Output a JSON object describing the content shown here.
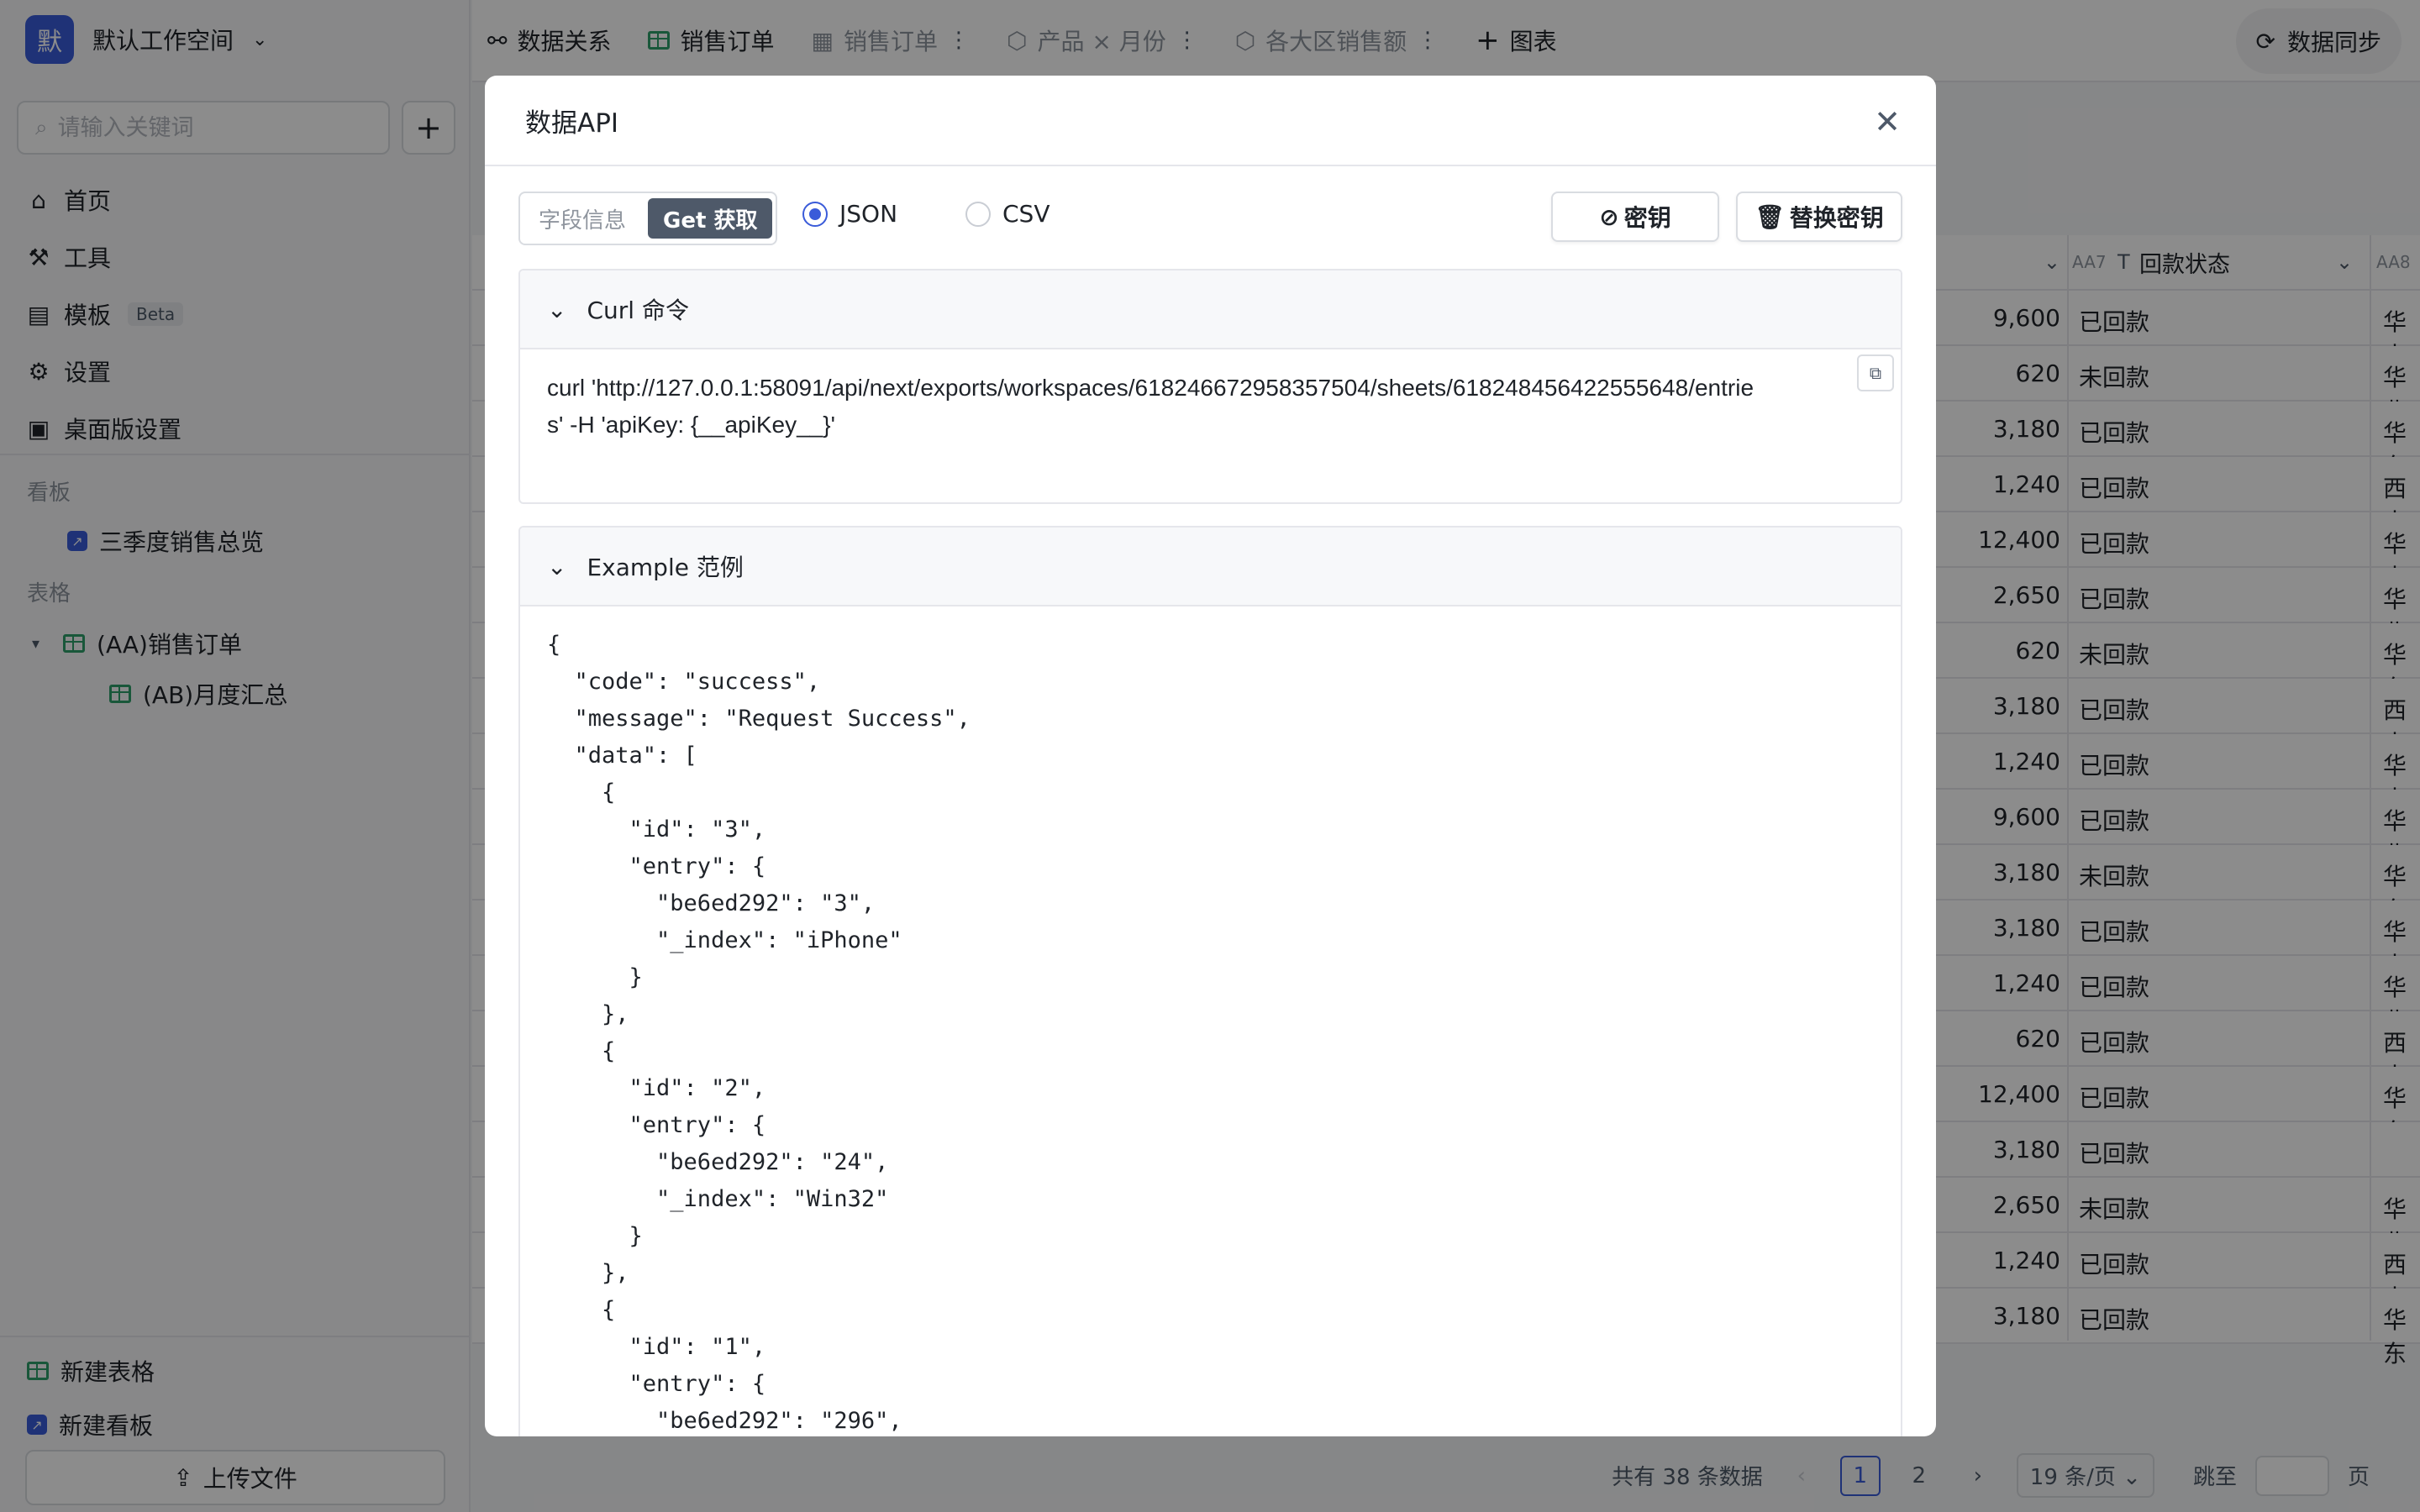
{
  "workspace": {
    "avatar": "默",
    "name": "默认工作空间"
  },
  "search": {
    "placeholder": "请输入关键词"
  },
  "nav": [
    {
      "label": "首页",
      "icon": "home-icon",
      "glyph": "⌂"
    },
    {
      "label": "工具",
      "icon": "wrench-icon",
      "glyph": "⚒"
    },
    {
      "label": "模板",
      "icon": "template-icon",
      "glyph": "▤",
      "badge": "Beta"
    },
    {
      "label": "设置",
      "icon": "gear-icon",
      "glyph": "⚙"
    },
    {
      "label": "桌面版设置",
      "icon": "desktop-icon",
      "glyph": "▣"
    }
  ],
  "sections": {
    "boards": "看板",
    "tables": "表格"
  },
  "tree": {
    "board1": "三季度销售总览",
    "table1": "(AA)销售订单",
    "table2": "(AB)月度汇总"
  },
  "bottom": {
    "new_table": "新建表格",
    "new_board": "新建看板",
    "upload": "上传文件"
  },
  "tabs": [
    {
      "label": "数据关系",
      "muted": false,
      "more": false
    },
    {
      "label": "销售订单",
      "muted": false,
      "more": false
    },
    {
      "label": "销售订单",
      "muted": true,
      "more": true
    },
    {
      "label": "产品 × 月份",
      "muted": true,
      "more": true
    },
    {
      "label": "各大区销售额",
      "muted": true,
      "more": true
    },
    {
      "label": "图表",
      "muted": false,
      "more": false
    }
  ],
  "sync": {
    "label": "数据同步"
  },
  "table": {
    "col_aa7_code": "AA7",
    "col_aa7_label": "回款状态",
    "col_aa8_code": "AA8",
    "rows": [
      {
        "amount": "9,600",
        "status": "已回款",
        "region": "华南"
      },
      {
        "amount": "620",
        "status": "未回款",
        "region": "华北"
      },
      {
        "amount": "3,180",
        "status": "已回款",
        "region": "华东"
      },
      {
        "amount": "1,240",
        "status": "已回款",
        "region": "西南"
      },
      {
        "amount": "12,400",
        "status": "已回款",
        "region": "华南"
      },
      {
        "amount": "2,650",
        "status": "已回款",
        "region": "华北"
      },
      {
        "amount": "620",
        "status": "未回款",
        "region": "华东"
      },
      {
        "amount": "3,180",
        "status": "已回款",
        "region": "西南"
      },
      {
        "amount": "1,240",
        "status": "已回款",
        "region": "华南"
      },
      {
        "amount": "9,600",
        "status": "已回款",
        "region": "华北"
      },
      {
        "amount": "3,180",
        "status": "未回款",
        "region": "华东"
      },
      {
        "amount": "3,180",
        "status": "已回款",
        "region": "华南"
      },
      {
        "amount": "1,240",
        "status": "已回款",
        "region": "华北"
      },
      {
        "amount": "620",
        "status": "已回款",
        "region": "西南"
      },
      {
        "amount": "12,400",
        "status": "已回款",
        "region": "华东"
      },
      {
        "amount": "3,180",
        "status": "已回款",
        "region": ""
      },
      {
        "amount": "2,650",
        "status": "未回款",
        "region": "华北"
      },
      {
        "amount": "1,240",
        "status": "已回款",
        "region": "西南"
      },
      {
        "amount": "3,180",
        "status": "已回款",
        "region": "华东"
      }
    ]
  },
  "pager": {
    "total": "共有 38 条数据",
    "page1": "1",
    "page2": "2",
    "per_page": "19 条/页",
    "jump": "跳至",
    "page_unit": "页"
  },
  "modal": {
    "title": "数据API",
    "seg_fields": "字段信息",
    "seg_get": "Get 获取",
    "radio_json": "JSON",
    "radio_csv": "CSV",
    "btn_key": "密钥",
    "btn_replace": "替换密钥",
    "curl_title": "Curl 命令",
    "curl_line1": "curl 'http://127.0.0.1:58091/api/next/exports/workspaces/618246672958357504/sheets/618248456422555648/entrie",
    "curl_line2": "s' -H 'apiKey: {__apiKey__}'",
    "example_title": "Example 范例",
    "example_code": "{\n  \"code\": \"success\",\n  \"message\": \"Request Success\",\n  \"data\": [\n    {\n      \"id\": \"3\",\n      \"entry\": {\n        \"be6ed292\": \"3\",\n        \"_index\": \"iPhone\"\n      }\n    },\n    {\n      \"id\": \"2\",\n      \"entry\": {\n        \"be6ed292\": \"24\",\n        \"_index\": \"Win32\"\n      }\n    },\n    {\n      \"id\": \"1\",\n      \"entry\": {\n        \"be6ed292\": \"296\","
  },
  "colors": {
    "accent": "#3a5bd9",
    "sheet_green": "#2f9e6a",
    "overlay": "rgba(0,0,0,0.45)"
  }
}
